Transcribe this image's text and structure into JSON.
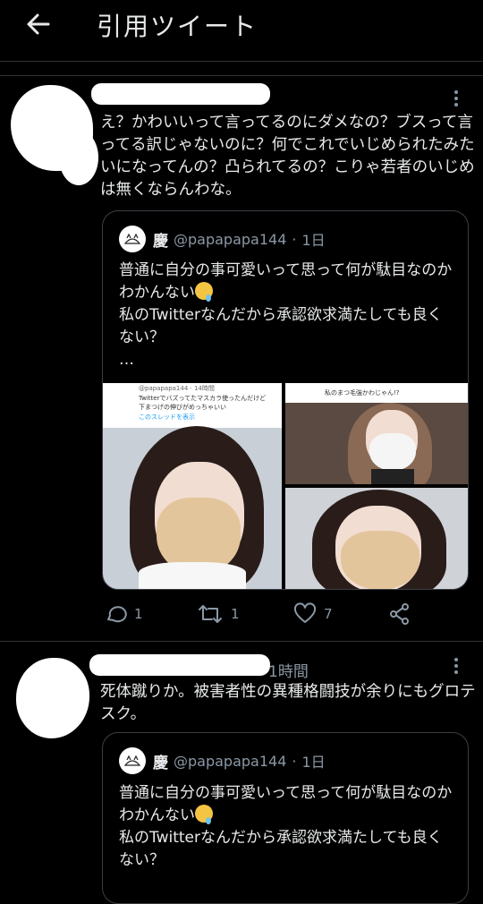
{
  "header": {
    "title": "引用ツイート",
    "back_icon": "arrow-left-icon"
  },
  "tweets": [
    {
      "text": "え？かわいいって言ってるのにダメなの？ブスって言ってる訳じゃないのに？何でこれでいじめられたみたいになってんの？凸られてるの？こりゃ若者のいじめは無くならんわな。",
      "quote": {
        "name": "慶",
        "handle": "@papapapa144",
        "time": "1日",
        "text_line1": "普通に自分の事可愛いって思って何が駄目なのかわかんない",
        "text_line2": "私のTwitterなんだから承認欲求満たしても良くない？",
        "ellipsis": "…",
        "media": {
          "a_meta": "@papapapa144 · 14時間",
          "a_text1": "Twitterでバズってたマスカラ使ったんだけど",
          "a_text2": "下まつげの伸びがめっちゃいい",
          "a_link": "このスレッドを表示",
          "b_text": "私のまつ毛強かわじゃん!?"
        }
      },
      "actions": {
        "reply": "1",
        "retweet": "1",
        "like": "7"
      }
    },
    {
      "time": "1時間",
      "text": "死体蹴りか。被害者性の異種格闘技が余りにもグロテスク。",
      "quote": {
        "name": "慶",
        "handle": "@papapapa144",
        "time": "1日",
        "text_line1": "普通に自分の事可愛いって思って何が駄目なのかわかんない",
        "text_line2": "私のTwitterなんだから承認欲求満たしても良くない？"
      }
    }
  ],
  "colors": {
    "background": "#000000",
    "text": "#e7e9ea",
    "muted": "#8b98a5",
    "border": "#2f3336"
  }
}
